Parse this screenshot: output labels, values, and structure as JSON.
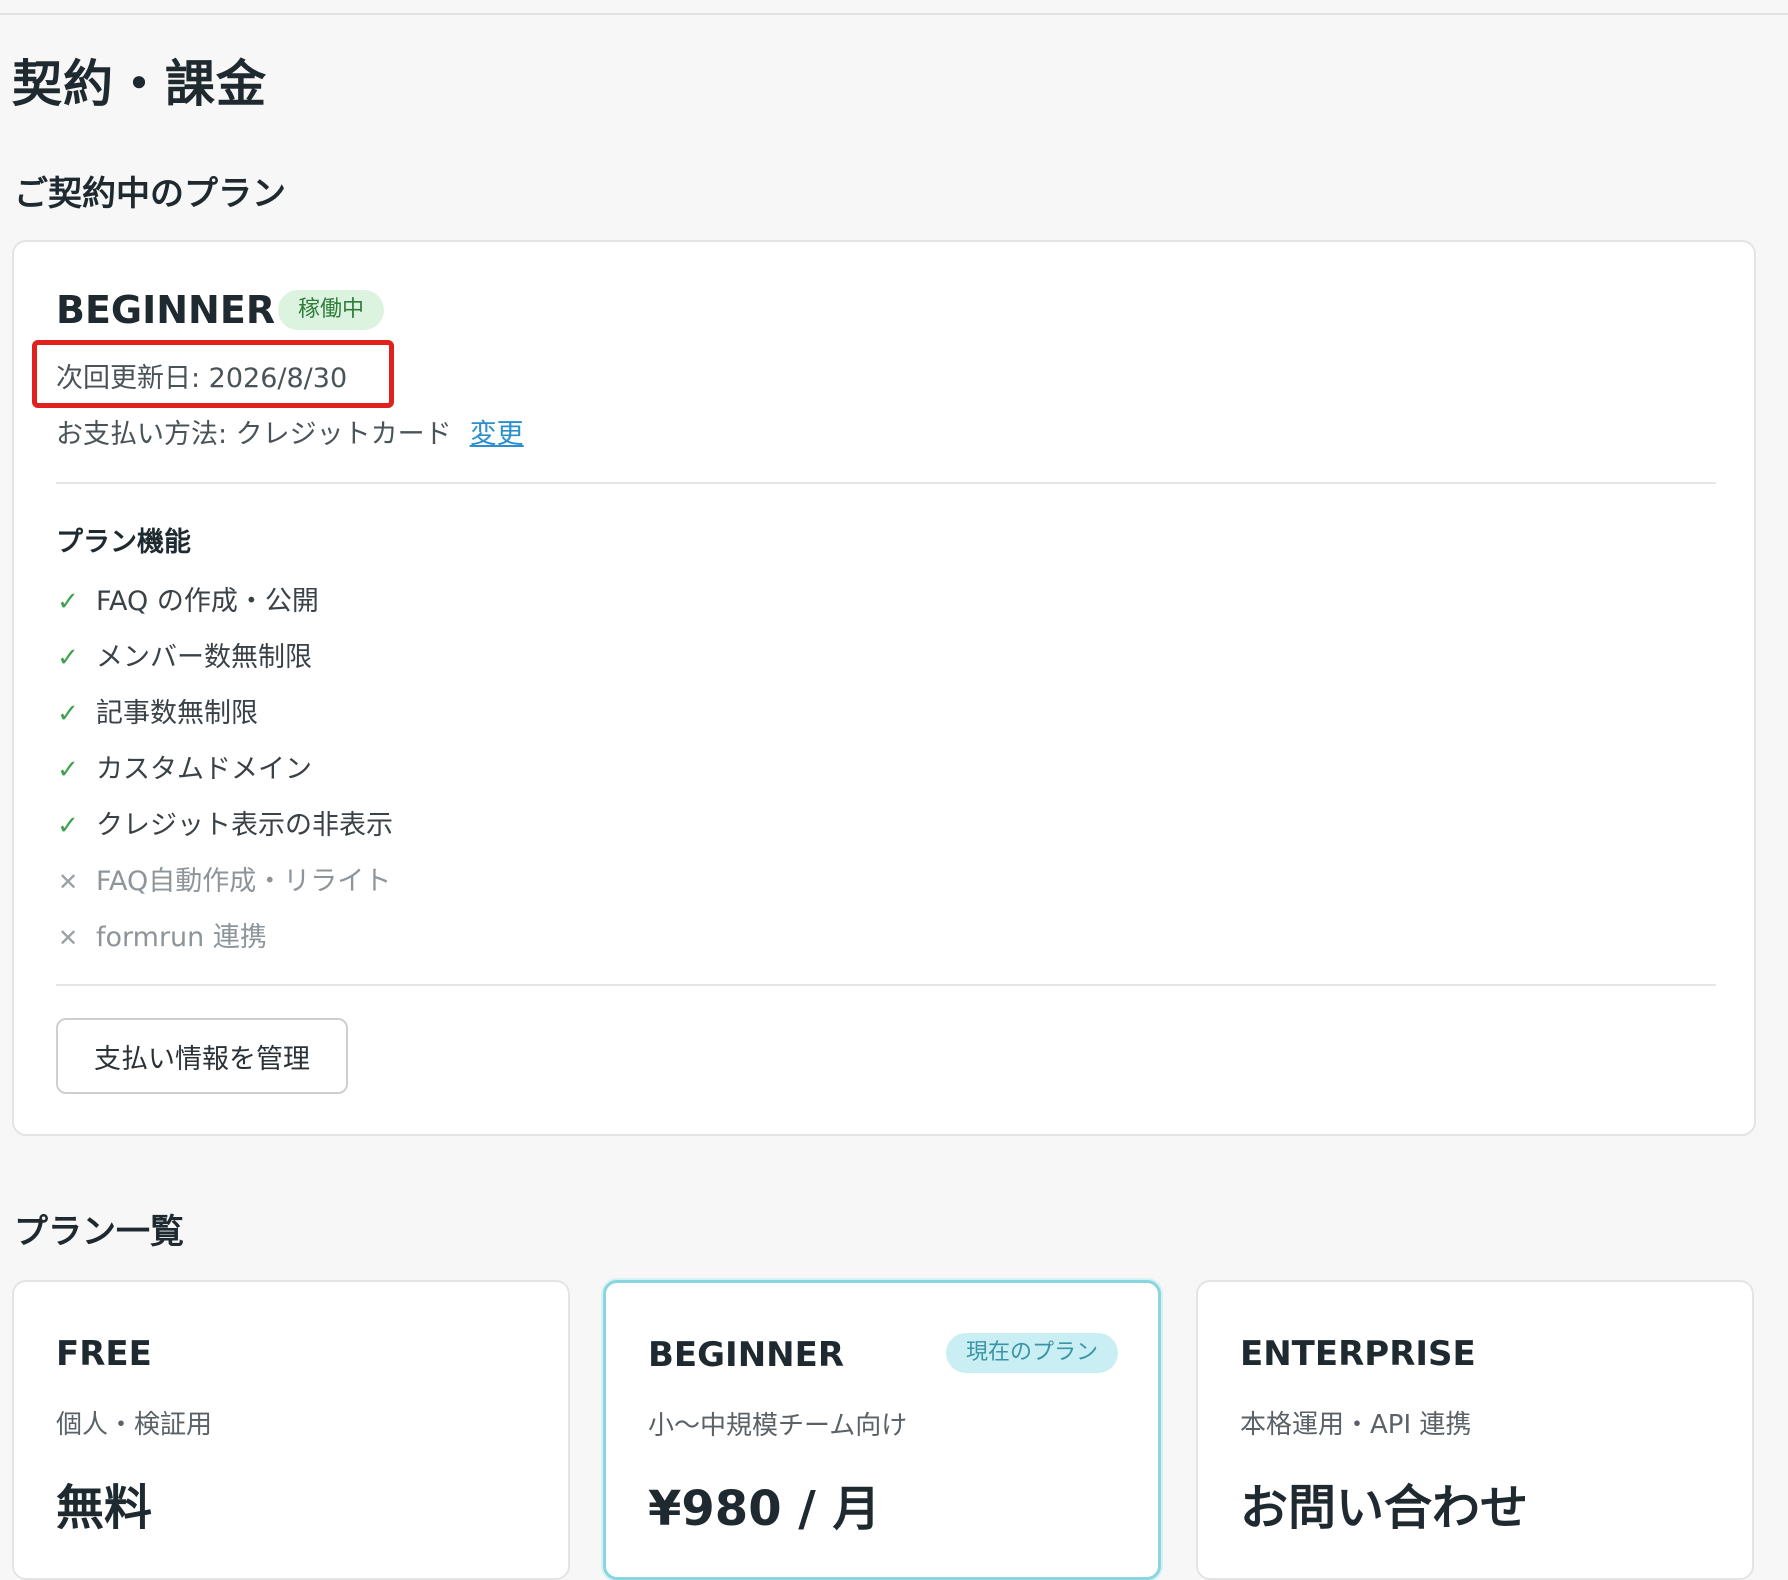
{
  "page": {
    "title": "契約・課金"
  },
  "current_plan": {
    "section_title": "ご契約中のプラン",
    "plan_name": "BEGINNER",
    "status": "稼働中",
    "next_renewal": "次回更新日: 2026/8/30",
    "payment_method": "お支払い方法: クレジットカード",
    "change_link": "変更",
    "features_title": "プラン機能",
    "features": [
      {
        "label": "FAQ の作成・公開",
        "icon": "check-icon",
        "enabled": true
      },
      {
        "label": "メンバー数無制限",
        "icon": "check-icon",
        "enabled": true
      },
      {
        "label": "記事数無制限",
        "icon": "check-icon",
        "enabled": true
      },
      {
        "label": "カスタムドメイン",
        "icon": "check-icon",
        "enabled": true
      },
      {
        "label": "クレジット表示の非表示",
        "icon": "check-icon",
        "enabled": true
      },
      {
        "label": "FAQ自動作成・リライト",
        "icon": "cross-icon",
        "enabled": false
      },
      {
        "label": "formrun 連携",
        "icon": "cross-icon",
        "enabled": false
      }
    ],
    "manage_button": "支払い情報を管理"
  },
  "plan_list": {
    "section_title": "プラン一覧",
    "plans": [
      {
        "name": "FREE",
        "description": "個人・検証用",
        "price": "無料",
        "badge": ""
      },
      {
        "name": "BEGINNER",
        "description": "小〜中規模チーム向け",
        "price": "¥980 / 月",
        "badge": "現在のプラン"
      },
      {
        "name": "ENTERPRISE",
        "description": "本格運用・API 連携",
        "price": "お問い合わせ",
        "badge": ""
      }
    ]
  },
  "colors": {
    "accent_link": "#2b8fcf",
    "status_green": "#2e7d3a",
    "check_green": "#3fa34d",
    "highlight_red": "#e0211d",
    "current_plan_border": "#8ad6e0"
  }
}
